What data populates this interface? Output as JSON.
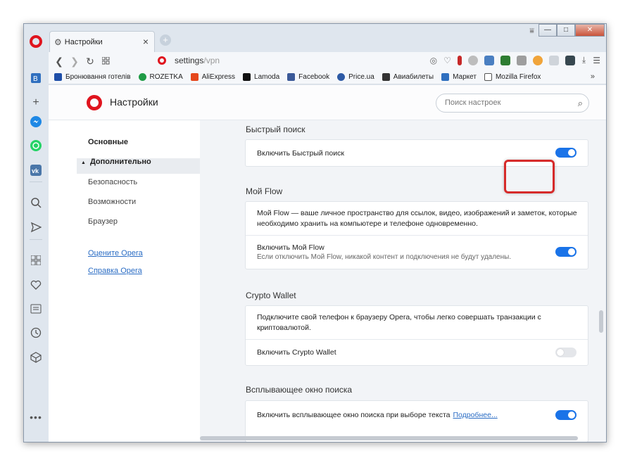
{
  "browser": {
    "tab_label": "Настройки",
    "tab_close": "×",
    "new_tab": "+",
    "window_buttons": [
      "—",
      "□",
      "✕"
    ],
    "url_host": "settings",
    "url_path": "/vpn"
  },
  "bookmarks": [
    {
      "label": "Бронювання готелів",
      "color": "#1e4ea8"
    },
    {
      "label": "ROZETKA",
      "color": "#1f9b46"
    },
    {
      "label": "AliExpress",
      "color": "#e5471c"
    },
    {
      "label": "Lamoda",
      "color": "#111111"
    },
    {
      "label": "Facebook",
      "color": "#3b5998"
    },
    {
      "label": "Price.ua",
      "color": "#2d5aa5"
    },
    {
      "label": "Авиабилеты",
      "color": "#333333"
    },
    {
      "label": "Маркет",
      "color": "#2f6fbf"
    },
    {
      "label": "Mozilla Firefox",
      "color": "#555555"
    }
  ],
  "bookmarks_more": "»",
  "settings": {
    "title": "Настройки",
    "search_placeholder": "Поиск настроек",
    "nav": {
      "basic": "Основные",
      "advanced": "Дополнительно",
      "security": "Безопасность",
      "features": "Возможности",
      "browser": "Браузер",
      "rate_link": "Оцените Opera",
      "help_link": "Справка Opera"
    },
    "sections": {
      "quick_search": {
        "title": "Быстрый поиск",
        "enable": "Включить Быстрый поиск",
        "enabled": true
      },
      "my_flow": {
        "title": "Мой Flow",
        "description_line1": "Мой Flow — ваше личное пространство для ссылок, видео, изображений и заметок, которые",
        "description_line2": "необходимо хранить на компьютере и телефоне одновременно.",
        "enable": "Включить Мой Flow",
        "enable_sub": "Если отключить Мой Flow, никакой контент и подключения не будут удалены.",
        "enabled": true
      },
      "crypto_wallet": {
        "title": "Crypto Wallet",
        "description_line1": "Подключите свой телефон к браузеру Opera, чтобы легко совершать транзакции с",
        "description_line2": "криптовалютой.",
        "enable": "Включить Crypto Wallet",
        "enabled": false
      },
      "search_popup": {
        "title": "Всплывающее окно поиска",
        "enable": "Включить всплывающее окно поиска при выборе текста",
        "more_link": "Подробнее...",
        "enabled": true
      }
    }
  },
  "colors": {
    "accent": "#1a73e8",
    "opera_red": "#e0141e",
    "highlight": "#d62a2a"
  }
}
